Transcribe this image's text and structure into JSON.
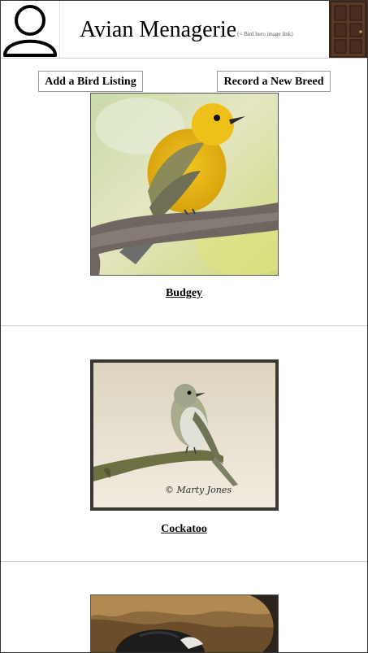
{
  "header": {
    "title": "Avian Menagerie",
    "hero_note": "(< Bird hero image link)",
    "avatar_icon": "user-avatar-icon",
    "door_icon": "door-icon"
  },
  "actions": {
    "add_listing": "Add a Bird Listing",
    "record_breed": "Record a New Breed"
  },
  "birds": [
    {
      "name": "Budgey",
      "image": "yellow-warbler-photo"
    },
    {
      "name": "Cockatoo",
      "image": "flycatcher-photo",
      "watermark": "© Marty Jones"
    },
    {
      "name": "",
      "image": "bird-in-cave-photo"
    }
  ],
  "colors": {
    "divider": "#d0d0d0",
    "button_border": "#9a9a9a"
  }
}
